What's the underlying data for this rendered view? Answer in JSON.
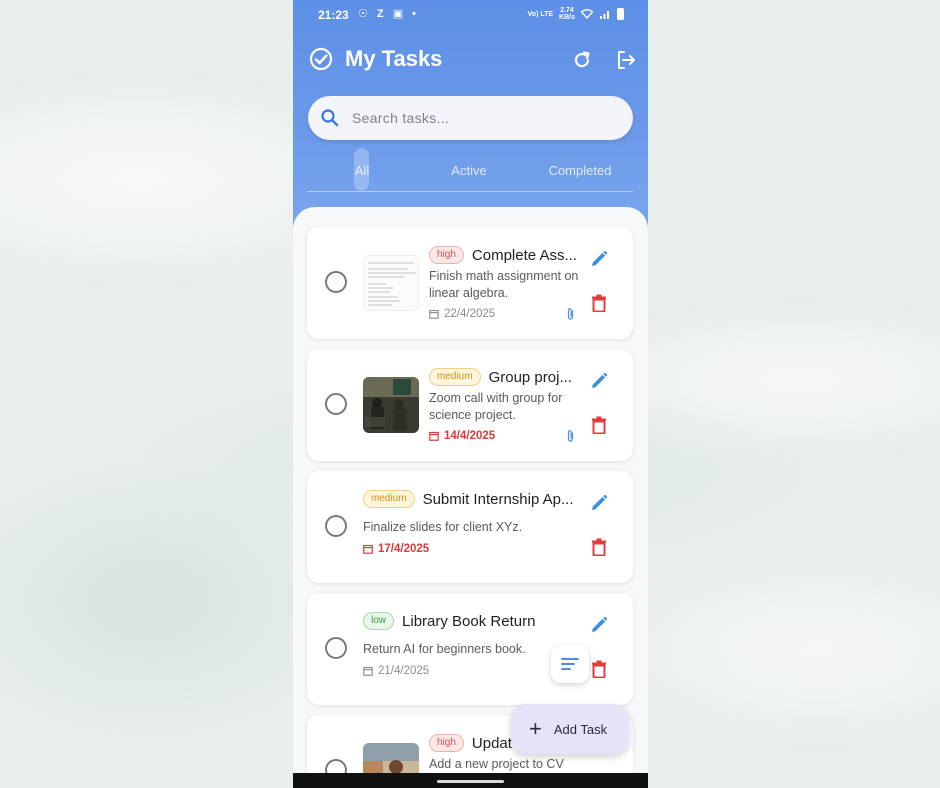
{
  "status_bar": {
    "time": "21:23",
    "left_icons": "☉ Z ▣ •",
    "network_speed": "2.74",
    "speed_unit": "KB/s",
    "lte_label": "Vo) LTE"
  },
  "header": {
    "title": "My Tasks"
  },
  "search": {
    "placeholder": "Search tasks..."
  },
  "tabs": [
    {
      "label": "All",
      "selected": true
    },
    {
      "label": "Active",
      "selected": false
    },
    {
      "label": "Completed",
      "selected": false
    }
  ],
  "tasks": [
    {
      "priority": "high",
      "title": "Complete Ass...",
      "description": "Finish math assignment on linear algebra.",
      "date": "22/4/2025",
      "overdue": false,
      "has_attachment": true,
      "has_image": true
    },
    {
      "priority": "medium",
      "title": "Group proj...",
      "description": "Zoom call with group for science project.",
      "date": "14/4/2025",
      "overdue": true,
      "has_attachment": true,
      "has_image": true
    },
    {
      "priority": "medium",
      "title": "Submit Internship Ap...",
      "description": "Finalize slides for client XYz.",
      "date": "17/4/2025",
      "overdue": true,
      "has_attachment": false,
      "has_image": false
    },
    {
      "priority": "low",
      "title": "Library Book Return",
      "description": "Return AI for beginners book.",
      "date": "21/4/2025",
      "overdue": false,
      "has_attachment": false,
      "has_image": false
    },
    {
      "priority": "high",
      "title": "Updat",
      "description": "Add a new project to CV",
      "date": "",
      "overdue": false,
      "has_attachment": false,
      "has_image": true
    }
  ],
  "fab": {
    "add_label": "Add Task",
    "add_glyph": "+"
  },
  "colors": {
    "header_blue": "#5c8fe6",
    "high": "#d9534f",
    "medium": "#d69415",
    "low": "#3c9a48",
    "edit_blue": "#3a8ee0",
    "delete_red": "#e03c3c"
  }
}
